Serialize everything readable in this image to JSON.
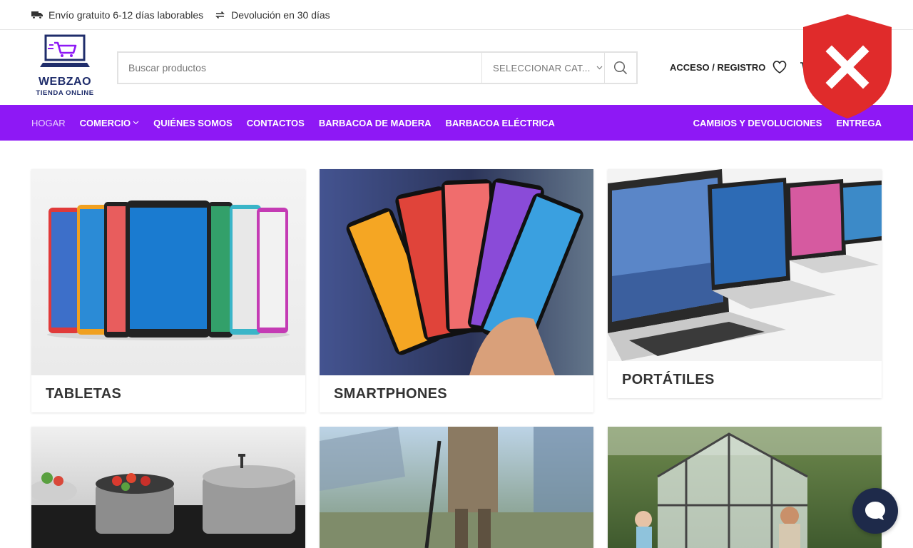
{
  "topbar": {
    "shipping": "Envío gratuito 6-12 días laborables",
    "returns": "Devolución en 30 días"
  },
  "logo": {
    "brand": "WEBZAO",
    "tagline": "TIENDA ONLINE"
  },
  "search": {
    "placeholder": "Buscar productos",
    "category": "SELECCIONAR CAT..."
  },
  "header": {
    "account": "ACCESO / REGISTRO"
  },
  "nav": {
    "left": [
      "HOGAR",
      "COMERCIO",
      "QUIÉNES SOMOS",
      "CONTACTOS",
      "BARBACOA DE MADERA",
      "BARBACOA ELÉCTRICA"
    ],
    "right": [
      "CAMBIOS Y DEVOLUCIONES",
      "ENTREGA"
    ]
  },
  "categories": [
    "TABLETAS",
    "SMARTPHONES",
    "PORTÁTILES"
  ],
  "colors": {
    "accent": "#8e18f5",
    "shield": "#e02b2b",
    "chat": "#1e2a4a"
  }
}
